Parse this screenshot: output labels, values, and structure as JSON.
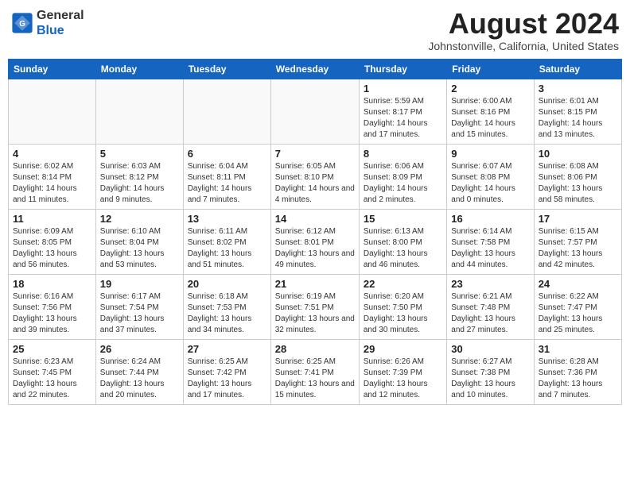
{
  "header": {
    "logo_line1": "General",
    "logo_line2": "Blue",
    "month_title": "August 2024",
    "location": "Johnstonville, California, United States"
  },
  "weekdays": [
    "Sunday",
    "Monday",
    "Tuesday",
    "Wednesday",
    "Thursday",
    "Friday",
    "Saturday"
  ],
  "weeks": [
    [
      null,
      null,
      null,
      null,
      {
        "day": 1,
        "sunrise": "5:59 AM",
        "sunset": "8:17 PM",
        "daylight": "14 hours and 17 minutes."
      },
      {
        "day": 2,
        "sunrise": "6:00 AM",
        "sunset": "8:16 PM",
        "daylight": "14 hours and 15 minutes."
      },
      {
        "day": 3,
        "sunrise": "6:01 AM",
        "sunset": "8:15 PM",
        "daylight": "14 hours and 13 minutes."
      }
    ],
    [
      {
        "day": 4,
        "sunrise": "6:02 AM",
        "sunset": "8:14 PM",
        "daylight": "14 hours and 11 minutes."
      },
      {
        "day": 5,
        "sunrise": "6:03 AM",
        "sunset": "8:12 PM",
        "daylight": "14 hours and 9 minutes."
      },
      {
        "day": 6,
        "sunrise": "6:04 AM",
        "sunset": "8:11 PM",
        "daylight": "14 hours and 7 minutes."
      },
      {
        "day": 7,
        "sunrise": "6:05 AM",
        "sunset": "8:10 PM",
        "daylight": "14 hours and 4 minutes."
      },
      {
        "day": 8,
        "sunrise": "6:06 AM",
        "sunset": "8:09 PM",
        "daylight": "14 hours and 2 minutes."
      },
      {
        "day": 9,
        "sunrise": "6:07 AM",
        "sunset": "8:08 PM",
        "daylight": "14 hours and 0 minutes."
      },
      {
        "day": 10,
        "sunrise": "6:08 AM",
        "sunset": "8:06 PM",
        "daylight": "13 hours and 58 minutes."
      }
    ],
    [
      {
        "day": 11,
        "sunrise": "6:09 AM",
        "sunset": "8:05 PM",
        "daylight": "13 hours and 56 minutes."
      },
      {
        "day": 12,
        "sunrise": "6:10 AM",
        "sunset": "8:04 PM",
        "daylight": "13 hours and 53 minutes."
      },
      {
        "day": 13,
        "sunrise": "6:11 AM",
        "sunset": "8:02 PM",
        "daylight": "13 hours and 51 minutes."
      },
      {
        "day": 14,
        "sunrise": "6:12 AM",
        "sunset": "8:01 PM",
        "daylight": "13 hours and 49 minutes."
      },
      {
        "day": 15,
        "sunrise": "6:13 AM",
        "sunset": "8:00 PM",
        "daylight": "13 hours and 46 minutes."
      },
      {
        "day": 16,
        "sunrise": "6:14 AM",
        "sunset": "7:58 PM",
        "daylight": "13 hours and 44 minutes."
      },
      {
        "day": 17,
        "sunrise": "6:15 AM",
        "sunset": "7:57 PM",
        "daylight": "13 hours and 42 minutes."
      }
    ],
    [
      {
        "day": 18,
        "sunrise": "6:16 AM",
        "sunset": "7:56 PM",
        "daylight": "13 hours and 39 minutes."
      },
      {
        "day": 19,
        "sunrise": "6:17 AM",
        "sunset": "7:54 PM",
        "daylight": "13 hours and 37 minutes."
      },
      {
        "day": 20,
        "sunrise": "6:18 AM",
        "sunset": "7:53 PM",
        "daylight": "13 hours and 34 minutes."
      },
      {
        "day": 21,
        "sunrise": "6:19 AM",
        "sunset": "7:51 PM",
        "daylight": "13 hours and 32 minutes."
      },
      {
        "day": 22,
        "sunrise": "6:20 AM",
        "sunset": "7:50 PM",
        "daylight": "13 hours and 30 minutes."
      },
      {
        "day": 23,
        "sunrise": "6:21 AM",
        "sunset": "7:48 PM",
        "daylight": "13 hours and 27 minutes."
      },
      {
        "day": 24,
        "sunrise": "6:22 AM",
        "sunset": "7:47 PM",
        "daylight": "13 hours and 25 minutes."
      }
    ],
    [
      {
        "day": 25,
        "sunrise": "6:23 AM",
        "sunset": "7:45 PM",
        "daylight": "13 hours and 22 minutes."
      },
      {
        "day": 26,
        "sunrise": "6:24 AM",
        "sunset": "7:44 PM",
        "daylight": "13 hours and 20 minutes."
      },
      {
        "day": 27,
        "sunrise": "6:25 AM",
        "sunset": "7:42 PM",
        "daylight": "13 hours and 17 minutes."
      },
      {
        "day": 28,
        "sunrise": "6:25 AM",
        "sunset": "7:41 PM",
        "daylight": "13 hours and 15 minutes."
      },
      {
        "day": 29,
        "sunrise": "6:26 AM",
        "sunset": "7:39 PM",
        "daylight": "13 hours and 12 minutes."
      },
      {
        "day": 30,
        "sunrise": "6:27 AM",
        "sunset": "7:38 PM",
        "daylight": "13 hours and 10 minutes."
      },
      {
        "day": 31,
        "sunrise": "6:28 AM",
        "sunset": "7:36 PM",
        "daylight": "13 hours and 7 minutes."
      }
    ]
  ],
  "labels": {
    "sunrise": "Sunrise:",
    "sunset": "Sunset:",
    "daylight": "Daylight:"
  }
}
